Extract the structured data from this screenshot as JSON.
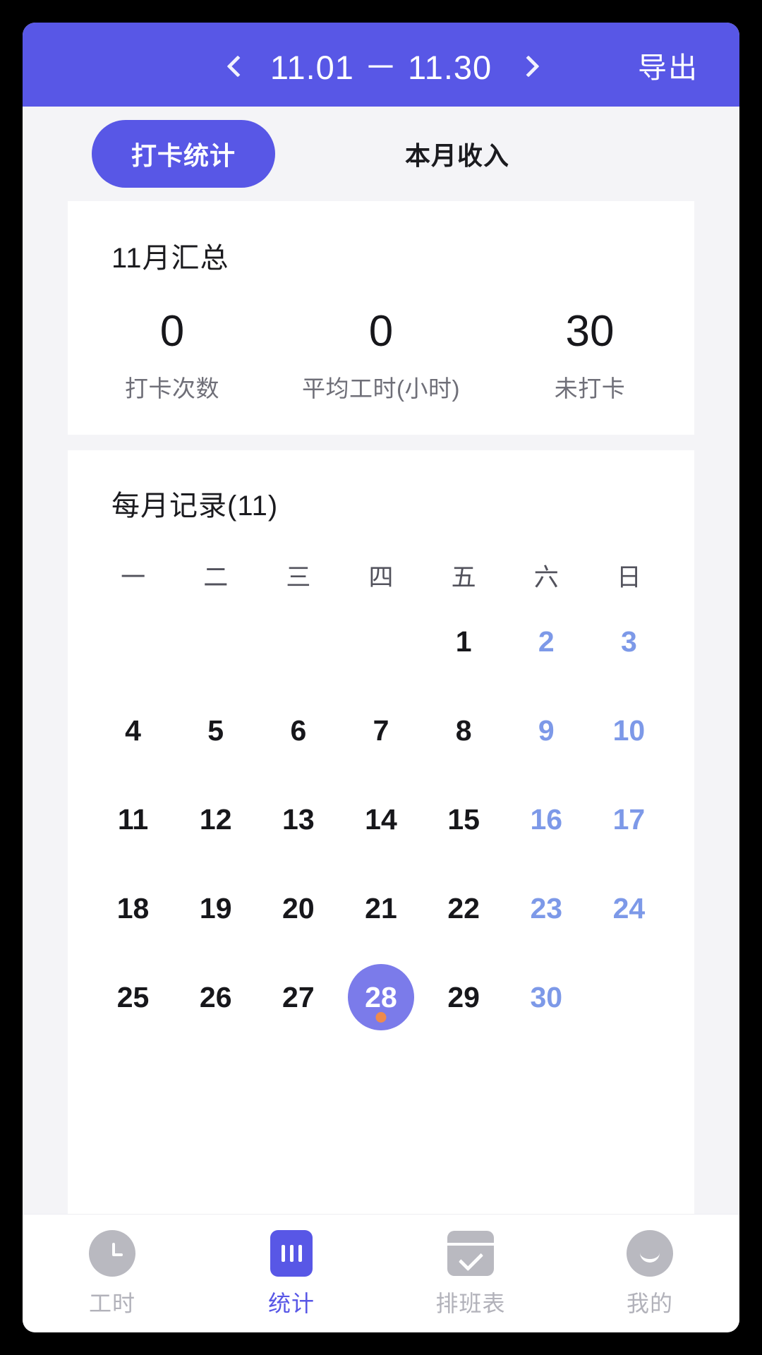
{
  "header": {
    "prev_icon": "chevron-left-icon",
    "date_range": "11.01 － 11.30",
    "next_icon": "chevron-right-icon",
    "export_label": "导出",
    "background_color": "#5857e6"
  },
  "tabs": [
    {
      "label": "打卡统计",
      "active": true
    },
    {
      "label": "本月收入",
      "active": false
    }
  ],
  "summary": {
    "title": "11月汇总",
    "stats": [
      {
        "value": "0",
        "label": "打卡次数"
      },
      {
        "value": "0",
        "label": "平均工时(小时)"
      },
      {
        "value": "30",
        "label": "未打卡"
      }
    ]
  },
  "calendar": {
    "title": "每月记录(11)",
    "weekdays": [
      "一",
      "二",
      "三",
      "四",
      "五",
      "六",
      "日"
    ],
    "selected_day": "28",
    "selected_dot_color": "#ef8a4c",
    "selected_bg_color": "#7b7bea",
    "weekend_color": "#7d99e8",
    "weeks": [
      [
        "",
        "",
        "",
        "",
        "1",
        "2",
        "3"
      ],
      [
        "4",
        "5",
        "6",
        "7",
        "8",
        "9",
        "10"
      ],
      [
        "11",
        "12",
        "13",
        "14",
        "15",
        "16",
        "17"
      ],
      [
        "18",
        "19",
        "20",
        "21",
        "22",
        "23",
        "24"
      ],
      [
        "25",
        "26",
        "27",
        "28",
        "29",
        "30",
        ""
      ]
    ]
  },
  "bottom_nav": [
    {
      "label": "工时",
      "icon": "clock-icon",
      "active": false
    },
    {
      "label": "统计",
      "icon": "bar-chart-icon",
      "active": true
    },
    {
      "label": "排班表",
      "icon": "calendar-check-icon",
      "active": false
    },
    {
      "label": "我的",
      "icon": "smiley-face-icon",
      "active": false
    }
  ]
}
